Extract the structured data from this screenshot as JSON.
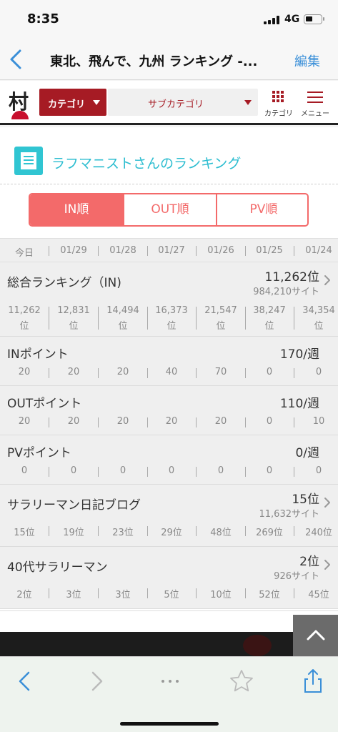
{
  "status_bar": {
    "time": "8:35",
    "network": "4G"
  },
  "nav": {
    "title": "東北、飛んで、九州 ランキング -...",
    "edit_label": "編集"
  },
  "site_header": {
    "logo_text": "村",
    "category_label": "カテゴリ",
    "subcategory_label": "サブカテゴリ",
    "category_icon_label": "カテゴリ",
    "menu_icon_label": "メニュー",
    "accent_color": "#a61b24"
  },
  "section": {
    "title": "ラフマニストさんのランキング",
    "title_color": "#2cbdd0"
  },
  "tabs": [
    {
      "label": "IN順",
      "active": true
    },
    {
      "label": "OUT順",
      "active": false
    },
    {
      "label": "PV順",
      "active": false
    }
  ],
  "dates": [
    "今日",
    "01/29",
    "01/28",
    "01/27",
    "01/26",
    "01/25",
    "01/24"
  ],
  "rows": [
    {
      "label": "総合ランキング（IN)",
      "value": "11,262位",
      "sub": "984,210サイト",
      "arrow": true,
      "history": [
        {
          "num": "11,262",
          "unit": "位"
        },
        {
          "num": "12,831",
          "unit": "位"
        },
        {
          "num": "14,494",
          "unit": "位"
        },
        {
          "num": "16,373",
          "unit": "位"
        },
        {
          "num": "21,547",
          "unit": "位"
        },
        {
          "num": "38,247",
          "unit": "位"
        },
        {
          "num": "34,354",
          "unit": "位"
        }
      ]
    },
    {
      "label": "INポイント",
      "value": "170/週",
      "history": [
        "20",
        "20",
        "20",
        "40",
        "70",
        "0",
        "0"
      ]
    },
    {
      "label": "OUTポイント",
      "value": "110/週",
      "history": [
        "20",
        "20",
        "20",
        "20",
        "20",
        "0",
        "10"
      ]
    },
    {
      "label": "PVポイント",
      "value": "0/週",
      "history": [
        "0",
        "0",
        "0",
        "0",
        "0",
        "0",
        "0"
      ]
    },
    {
      "label": "サラリーマン日記ブログ",
      "value": "15位",
      "sub": "11,632サイト",
      "arrow": true,
      "history": [
        "15位",
        "19位",
        "23位",
        "29位",
        "48位",
        "269位",
        "240位"
      ]
    },
    {
      "label": "40代サラリーマン",
      "value": "2位",
      "sub": "926サイト",
      "arrow": true,
      "history": [
        "2位",
        "3位",
        "3位",
        "5位",
        "10位",
        "52位",
        "45位"
      ]
    }
  ]
}
